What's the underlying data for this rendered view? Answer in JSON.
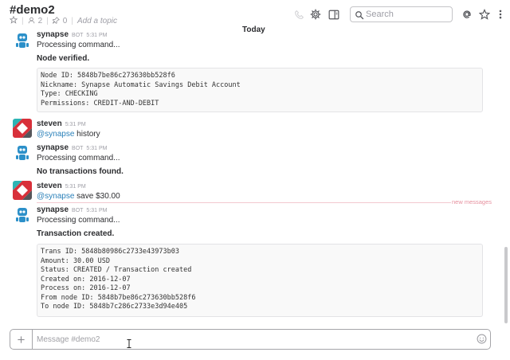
{
  "header": {
    "channel_name": "#demo2",
    "members_count": "2",
    "pins_count": "0",
    "topic_placeholder": "Add a topic",
    "search_placeholder": "Search"
  },
  "day_divider": "Today",
  "new_messages_label": "new messages",
  "messages": [
    {
      "author": "synapse",
      "bot_badge": "BOT",
      "time": "5:31 PM",
      "lines": [
        "Processing command...",
        "Node verified."
      ],
      "code": [
        "Node ID: 5848b7be86c273630bb528f6",
        "Nickname: Synapse Automatic Savings Debit Account",
        "Type: CHECKING",
        "Permissions: CREDIT-AND-DEBIT"
      ]
    },
    {
      "author": "steven",
      "time": "5:31 PM",
      "mention": "@synapse",
      "text": " history"
    },
    {
      "author": "synapse",
      "bot_badge": "BOT",
      "time": "5:31 PM",
      "lines": [
        "Processing command...",
        "No transactions found."
      ]
    },
    {
      "author": "steven",
      "time": "5:31 PM",
      "mention": "@synapse",
      "text": " save $30.00"
    },
    {
      "author": "synapse",
      "bot_badge": "BOT",
      "time": "5:31 PM",
      "lines": [
        "Processing command...",
        "Transaction created."
      ],
      "code": [
        "Trans ID: 5848b80986c2733e43973b03",
        "Amount: 30.00 USD",
        "Status: CREATED / Transaction created",
        "Created on: 2016-12-07",
        "Process on: 2016-12-07",
        "From node ID: 5848b7be86c273630bb528f6",
        "To node ID: 5848b7c286c2733e3d94e405"
      ]
    }
  ],
  "composer": {
    "placeholder": "Message #demo2"
  },
  "colors": {
    "mention": "#2a80b9",
    "new_messages": "#e6909e",
    "bot_blue": "#2c90c9",
    "steven_red": "#d8303a"
  }
}
